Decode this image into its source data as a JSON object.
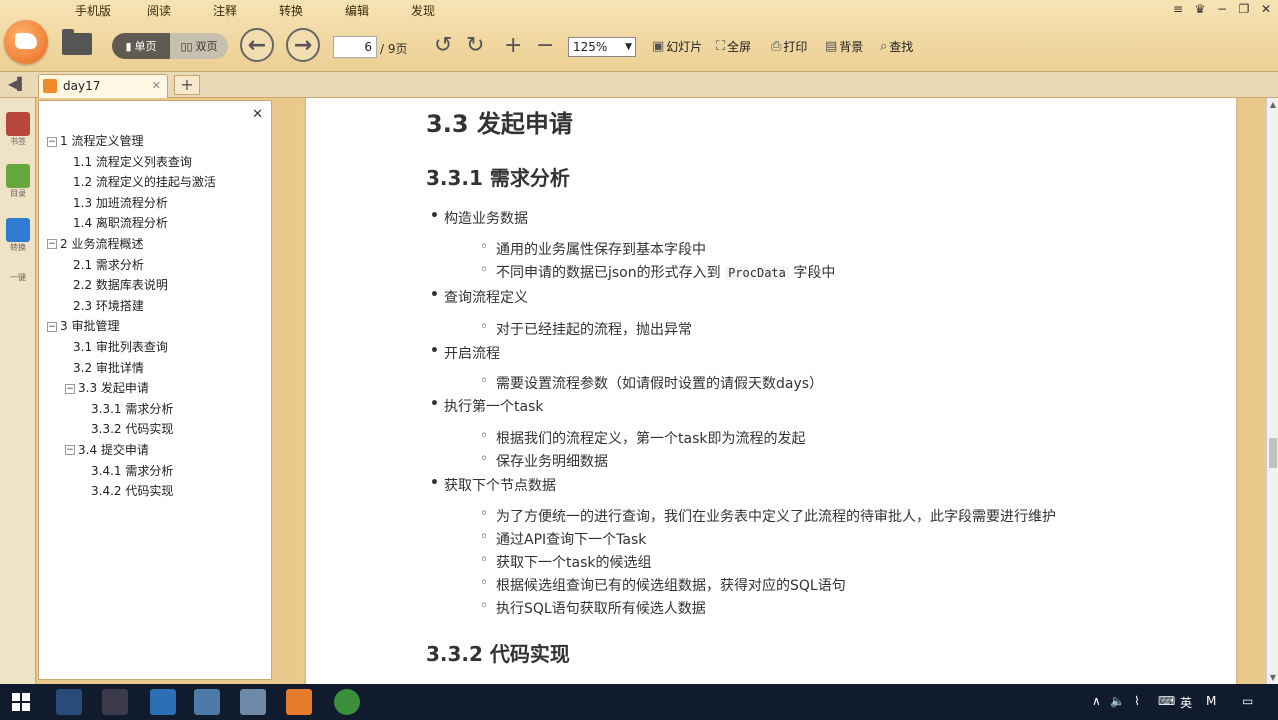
{
  "menu": [
    "手机版",
    "阅读",
    "注释",
    "转换",
    "编辑",
    "发现"
  ],
  "toolbar": {
    "single_page": "单页",
    "double_page": "双页",
    "current_page": "6",
    "page_total": "/ 9页",
    "zoom": "125%",
    "slideshow": "幻灯片",
    "fullscreen": "全屏",
    "print": "打印",
    "background": "背景",
    "search": "查找"
  },
  "tab": {
    "name": "day17",
    "add": "+"
  },
  "left_strip": [
    "书签",
    "目录",
    "转换",
    "一键"
  ],
  "outline": [
    {
      "label": "1 流程定义管理",
      "level": 0,
      "exp": "−"
    },
    {
      "label": "1.1 流程定义列表查询",
      "level": 1
    },
    {
      "label": "1.2 流程定义的挂起与激活",
      "level": 1
    },
    {
      "label": "1.3 加班流程分析",
      "level": 1
    },
    {
      "label": "1.4 离职流程分析",
      "level": 1
    },
    {
      "label": "2 业务流程概述",
      "level": 0,
      "exp": "−"
    },
    {
      "label": "2.1 需求分析",
      "level": 1
    },
    {
      "label": "2.2 数据库表说明",
      "level": 1
    },
    {
      "label": "2.3 环境搭建",
      "level": 1
    },
    {
      "label": "3 审批管理",
      "level": 0,
      "exp": "−"
    },
    {
      "label": "3.1 审批列表查询",
      "level": 1
    },
    {
      "label": "3.2 审批详情",
      "level": 1
    },
    {
      "label": "3.3 发起申请",
      "level": 1,
      "exp": "−"
    },
    {
      "label": "3.3.1 需求分析",
      "level": 2
    },
    {
      "label": "3.3.2 代码实现",
      "level": 2
    },
    {
      "label": "3.4 提交申请",
      "level": 1,
      "exp": "−"
    },
    {
      "label": "3.4.1 需求分析",
      "level": 2
    },
    {
      "label": "3.4.2 代码实现",
      "level": 2
    }
  ],
  "doc": {
    "h2": "3.3 发起申请",
    "h3a": "3.3.1 需求分析",
    "b1": "构造业务数据",
    "b1_1": "通用的业务属性保存到基本字段中",
    "b1_2_pre": "不同申请的数据已json的形式存入到",
    "b1_2_code": "ProcData",
    "b1_2_post": "字段中",
    "b2": "查询流程定义",
    "b2_1": "对于已经挂起的流程，抛出异常",
    "b3": "开启流程",
    "b3_1": "需要设置流程参数（如请假时设置的请假天数days）",
    "b4": "执行第一个task",
    "b4_1": "根据我们的流程定义，第一个task即为流程的发起",
    "b4_2": "保存业务明细数据",
    "b5": "获取下个节点数据",
    "b5_1": "为了方便统一的进行查询，我们在业务表中定义了此流程的待审批人，此字段需要进行维护",
    "b5_2": "通过API查询下一个Task",
    "b5_3": "获取下一个task的候选组",
    "b5_4": "根据候选组查询已有的候选组数据，获得对应的SQL语句",
    "b5_5": "执行SQL语句获取所有候选人数据",
    "h3b": "3.3.2 代码实现"
  },
  "tray": {
    "ime": "英",
    "ime2": "M"
  }
}
